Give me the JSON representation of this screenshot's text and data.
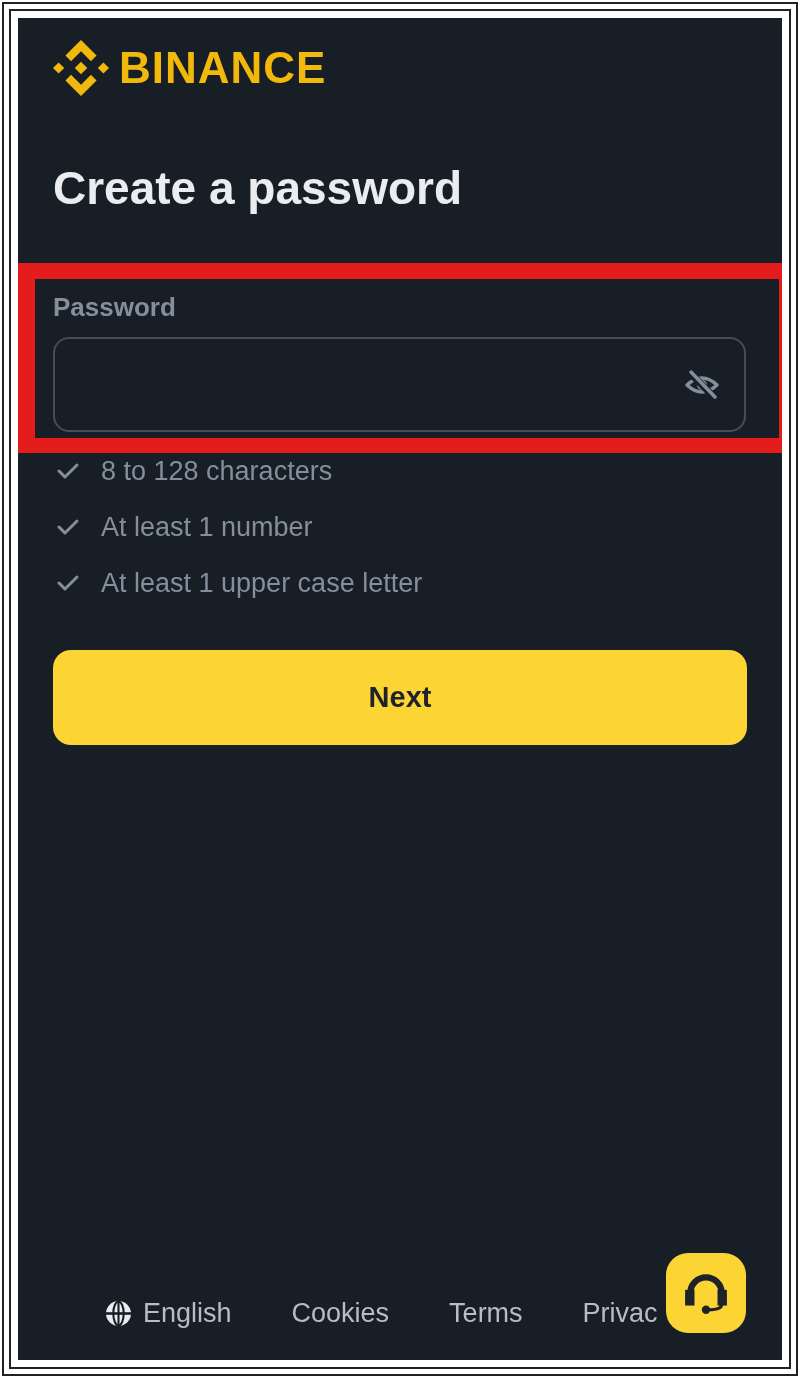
{
  "brand": {
    "name": "BINANCE"
  },
  "title": "Create a password",
  "password_field": {
    "label": "Password",
    "highlighted": true,
    "revealed": false
  },
  "requirements": [
    {
      "text": "8 to 128 characters",
      "met": false
    },
    {
      "text": "At least 1 number",
      "met": false
    },
    {
      "text": "At least 1 upper case letter",
      "met": false
    }
  ],
  "next_button": {
    "label": "Next"
  },
  "footer": {
    "language": "English",
    "links": [
      "Cookies",
      "Terms",
      "Privac"
    ]
  }
}
